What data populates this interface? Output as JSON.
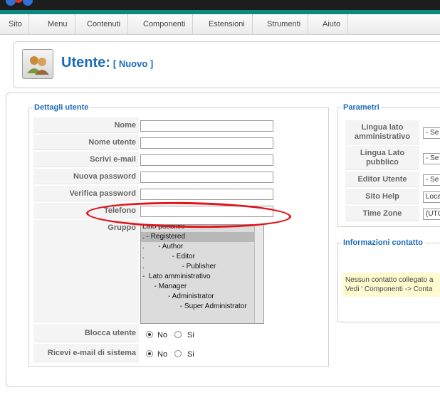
{
  "menu": {
    "items": [
      "Sito",
      "Menu",
      "Contenuti",
      "Componenti",
      "Estensioni",
      "Strumenti",
      "Aiuto"
    ]
  },
  "header": {
    "title": "Utente:",
    "subtitle": "[ Nuovo ]"
  },
  "user_details": {
    "legend": "Dettagli utente",
    "fields": [
      {
        "label": "Nome",
        "value": ""
      },
      {
        "label": "Nome utente",
        "value": ""
      },
      {
        "label": "Scrivi e-mail",
        "value": ""
      },
      {
        "label": "Nuova password",
        "value": ""
      },
      {
        "label": "Verifica password",
        "value": ""
      },
      {
        "label": "Telefono",
        "value": ""
      }
    ],
    "group_label": "Gruppo",
    "groups": [
      "Lato pubblico",
      ". - Registered",
      ".       - Author",
      ".              - Editor",
      ".                   - Publisher",
      "-  Lato amministrativo",
      "      - Manager",
      "             - Administrator",
      "                   - Super Administrator"
    ],
    "selected_group": ". - Registered",
    "block_user": {
      "label": "Blocca utente",
      "options": [
        "No",
        "Si"
      ],
      "selected": "No"
    },
    "system_email": {
      "label": "Ricevi e-mail di sistema",
      "options": [
        "No",
        "Si"
      ],
      "selected": "No"
    }
  },
  "parameters": {
    "legend": "Parametri",
    "rows": [
      {
        "label": "Lingua lato amministrativo",
        "value": "- Se"
      },
      {
        "label": "Lingua Lato pubblico",
        "value": "- Se"
      },
      {
        "label": "Editor Utente",
        "value": "- Se"
      },
      {
        "label": "Sito Help",
        "value": "Loca"
      },
      {
        "label": "Time Zone",
        "value": "(UTC"
      }
    ]
  },
  "contact_info": {
    "legend": "Informazioni contatto",
    "line1": "Nessun contatto collegato a",
    "line2": "Vedi ' Componenti -> Conta"
  },
  "colors": {
    "accent": "#1a6bb8",
    "highlight_ellipse": "#e0141b",
    "teal_bar": "#0d8a80"
  }
}
